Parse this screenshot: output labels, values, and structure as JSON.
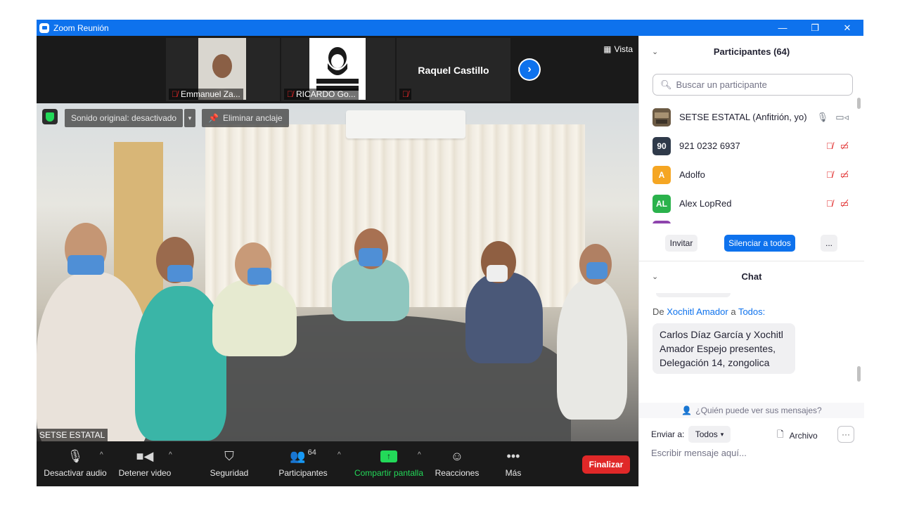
{
  "window": {
    "title": "Zoom Reunión",
    "controls": [
      "—",
      "❐",
      "✕"
    ]
  },
  "strip": {
    "thumbnails": [
      {
        "name": "Emmanuel Za..."
      },
      {
        "name": "RICARDO Go...",
        "avatar_text": "RICARDO GONZALEZ"
      },
      {
        "name": "Raquel Castillo"
      }
    ],
    "view_label": "Vista"
  },
  "main_video": {
    "sound_label": "Sonido original: desactivado",
    "unpin_label": "Eliminar anclaje",
    "speaker_name": "SETSE ESTATAL"
  },
  "toolbar": {
    "mute": "Desactivar audio",
    "video": "Detener video",
    "security": "Seguridad",
    "participants": "Participantes",
    "participants_count": "64",
    "share": "Compartir pantalla",
    "reactions": "Reacciones",
    "more": "Más",
    "end": "Finalizar"
  },
  "participants_panel": {
    "title": "Participantes (64)",
    "search_placeholder": "Buscar un participante",
    "items": [
      {
        "name": "SETSE ESTATAL (Anfitrión, yo)",
        "avatar": "",
        "color": "#6b5a44"
      },
      {
        "name": "921 0232 6937",
        "avatar": "90",
        "color": "#2f3a4a"
      },
      {
        "name": "Adolfo",
        "avatar": "A",
        "color": "#f5a623"
      },
      {
        "name": "Alex LopRed",
        "avatar": "AL",
        "color": "#2bb24c"
      }
    ],
    "invite": "Invitar",
    "mute_all": "Silenciar a todos",
    "more": "..."
  },
  "chat_panel": {
    "title": "Chat",
    "from_prefix": "De",
    "from_name": "Xochitl Amador",
    "to_word": "a",
    "to_name": "Todos:",
    "message": "Carlos Díaz García y Xochitl Amador Espejo presentes, Delegación 14, zongolica",
    "who_can_see": "¿Quién puede ver sus mensajes?",
    "send_to_label": "Enviar a:",
    "send_to_value": "Todos",
    "file_label": "Archivo",
    "input_placeholder": "Escribir mensaje aquí..."
  },
  "colors": {
    "zoom_blue": "#0e72ed",
    "end_red": "#e02828",
    "share_green": "#23d959"
  }
}
